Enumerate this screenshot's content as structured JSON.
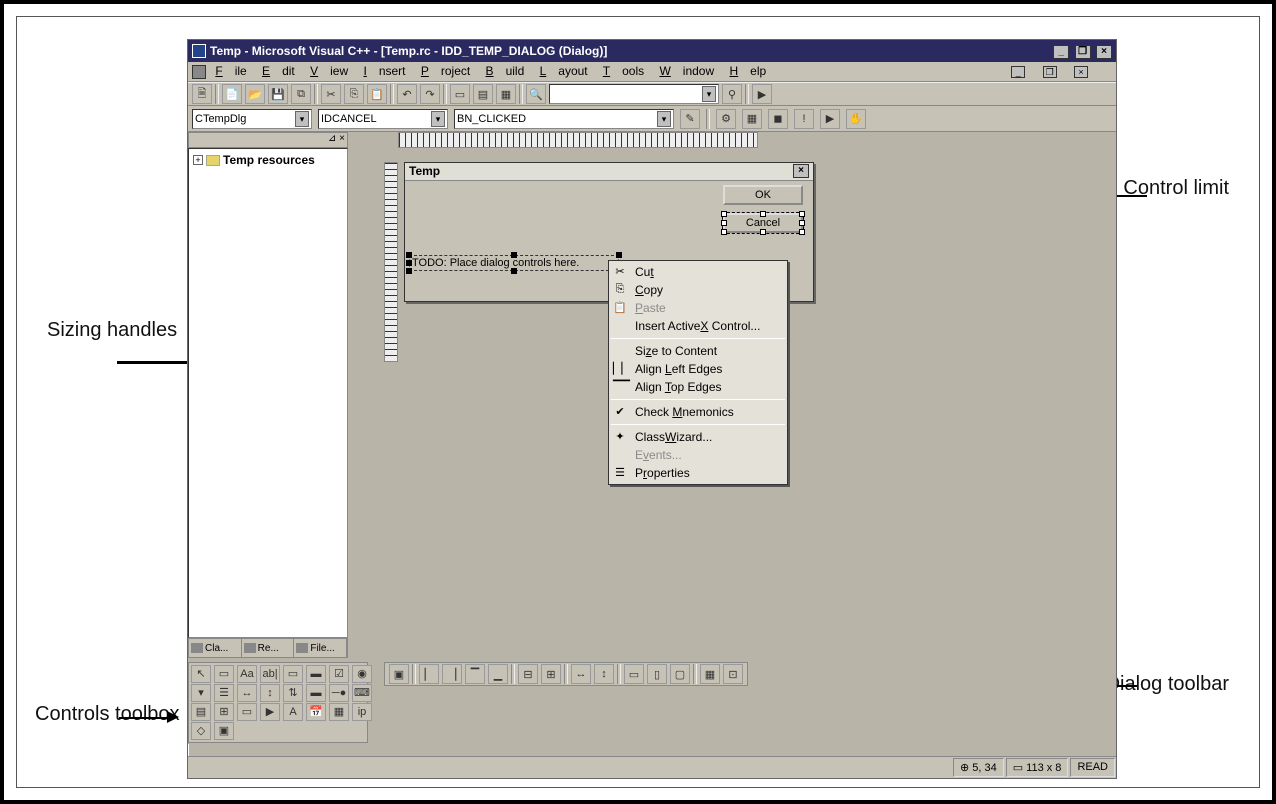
{
  "window": {
    "title": "Temp - Microsoft Visual C++ - [Temp.rc - IDD_TEMP_DIALOG (Dialog)]"
  },
  "menubar": {
    "items": [
      "File",
      "Edit",
      "View",
      "Insert",
      "Project",
      "Build",
      "Layout",
      "Tools",
      "Window",
      "Help"
    ]
  },
  "combo_row": {
    "class_combo": "CTempDlg",
    "id_combo": "IDCANCEL",
    "msg_combo": "BN_CLICKED"
  },
  "resource_tree": {
    "root": "Temp resources",
    "tabs": [
      "Cla...",
      "Re...",
      "File..."
    ]
  },
  "dialog_design": {
    "title": "Temp",
    "ok_label": "OK",
    "cancel_label": "Cancel",
    "todo_label": "TODO: Place dialog controls here."
  },
  "context_menu": {
    "cut": "Cut",
    "copy": "Copy",
    "paste": "Paste",
    "insert_ax": "Insert ActiveX Control...",
    "size_content": "Size to Content",
    "align_left": "Align Left Edges",
    "align_top": "Align Top Edges",
    "check_mnemonics": "Check Mnemonics",
    "classwizard": "ClassWizard...",
    "events": "Events...",
    "properties": "Properties"
  },
  "status_bar": {
    "coords": "5, 34",
    "size": "113 x 8",
    "mode": "READ"
  },
  "annotations": {
    "control_limit": "Control limit",
    "sizing_handles": "Sizing handles",
    "controls_toolbox": "Controls toolbox",
    "dialog_toolbar": "Dialog toolbar"
  }
}
